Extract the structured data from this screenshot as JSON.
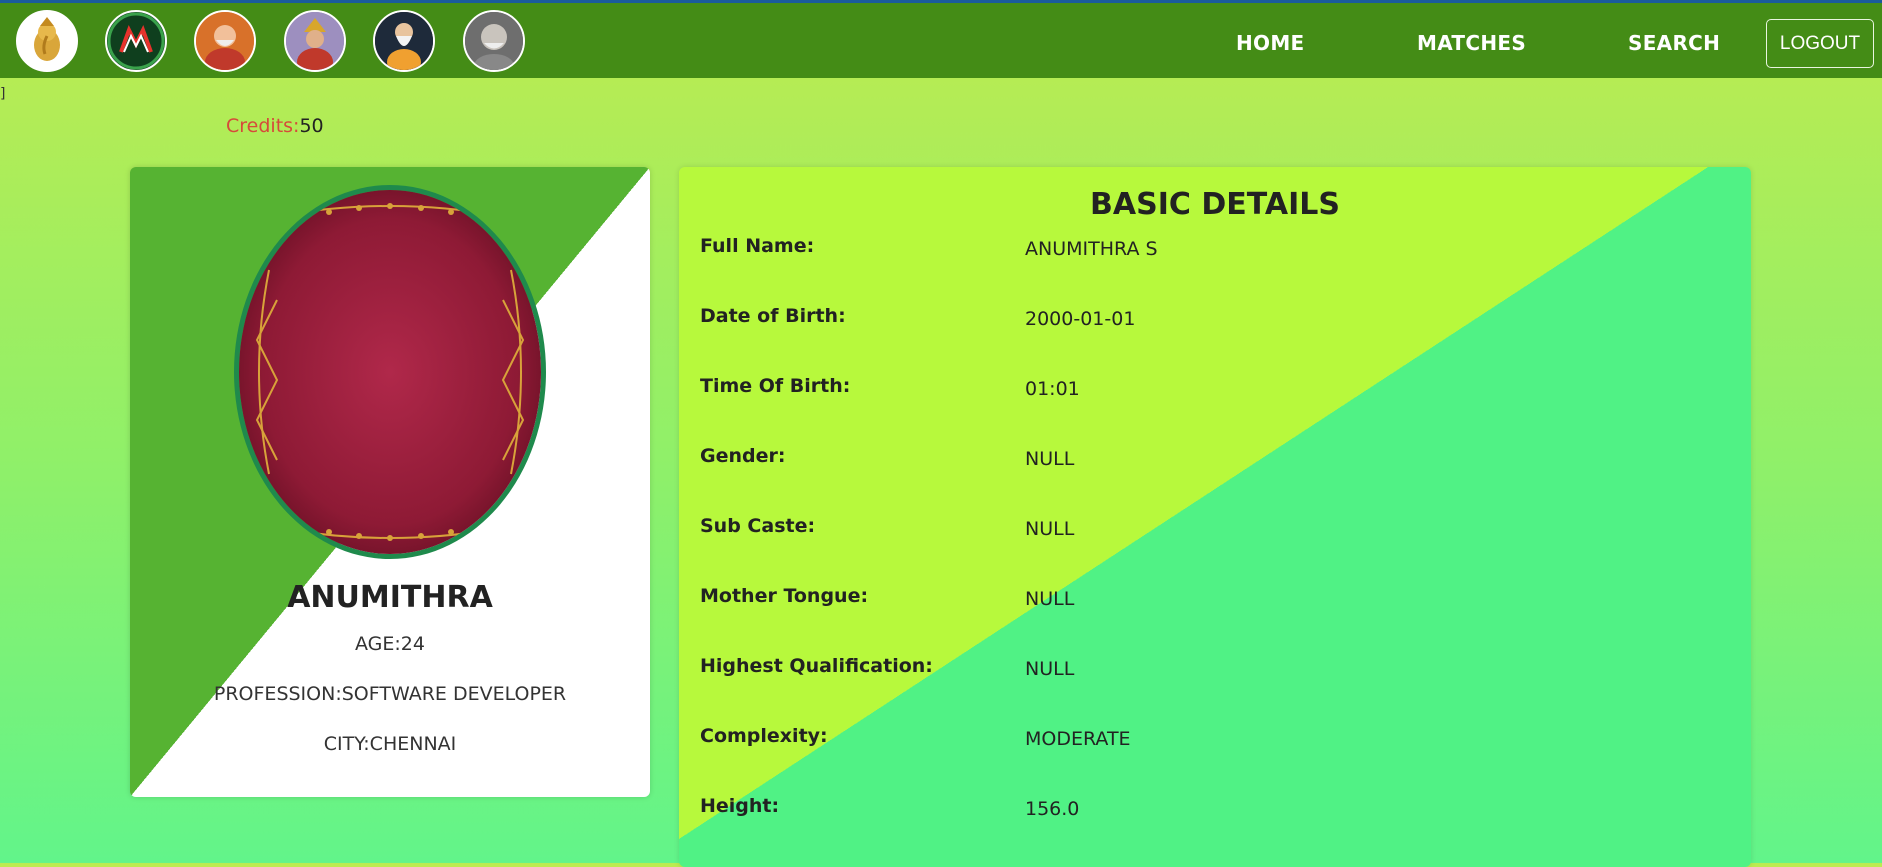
{
  "header": {
    "nav": {
      "home": "HOME",
      "matches": "MATCHES",
      "search": "SEARCH",
      "logout": "LOGOUT"
    },
    "icons": [
      "ganesha-icon",
      "site-logo-icon",
      "saint-1-icon",
      "deity-icon",
      "saint-2-icon",
      "saint-3-icon"
    ]
  },
  "stray_text": "]",
  "credits": {
    "label": "Credits:",
    "value": "50"
  },
  "profile": {
    "name": "ANUMITHRA",
    "age": "AGE:24",
    "profession": "PROFESSION:SOFTWARE DEVELOPER",
    "city": "CITY:CHENNAI"
  },
  "details": {
    "title": "BASIC DETAILS",
    "rows": [
      {
        "label": "Full Name:",
        "value": "ANUMITHRA S"
      },
      {
        "label": "Date of Birth:",
        "value": "2000-01-01"
      },
      {
        "label": "Time Of Birth:",
        "value": "01:01"
      },
      {
        "label": "Gender:",
        "value": "NULL"
      },
      {
        "label": "Sub Caste:",
        "value": "NULL"
      },
      {
        "label": "Mother Tongue:",
        "value": "NULL"
      },
      {
        "label": "Highest Qualification:",
        "value": "NULL"
      },
      {
        "label": "Complexity:",
        "value": "MODERATE"
      },
      {
        "label": "Height:",
        "value": "156.0"
      }
    ]
  },
  "colors": {
    "topbar": "#448c16",
    "credits_label": "#d64a3a",
    "photo_border": "#1f8a4c"
  }
}
